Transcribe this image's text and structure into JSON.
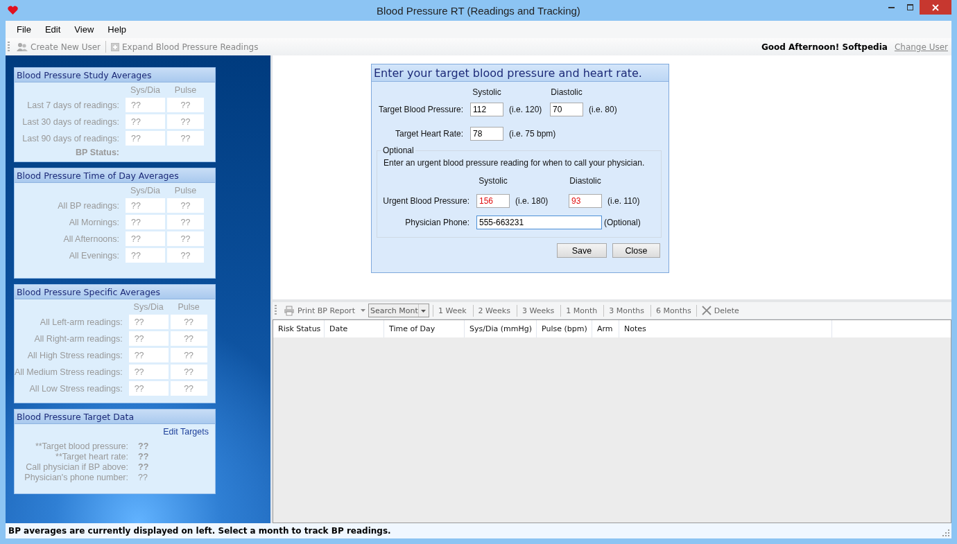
{
  "window": {
    "title": "Blood Pressure RT (Readings and Tracking)"
  },
  "menu": [
    "File",
    "Edit",
    "View",
    "Help"
  ],
  "toolbar": {
    "items": [
      {
        "label": "Create New User",
        "kind": "users"
      },
      {
        "label": "Expand Blood Pressure Readings",
        "kind": "expand"
      }
    ],
    "greeting": "Good Afternoon! Softpedia",
    "link": "Change User"
  },
  "panels": [
    {
      "title": "Blood Pressure Study Averages",
      "kind": "averages",
      "columns": [
        "Sys/Dia",
        "Pulse"
      ],
      "rows": [
        {
          "label": "Last 7 days of readings:",
          "sys_dia": "??",
          "pulse": "??"
        },
        {
          "label": "Last 30 days of readings:",
          "sys_dia": "??",
          "pulse": "??"
        },
        {
          "label": "Last 90 days of readings:",
          "sys_dia": "??",
          "pulse": "??"
        }
      ],
      "status_label": "BP Status:"
    },
    {
      "title": "Blood Pressure Time of Day Averages",
      "kind": "averages",
      "columns": [
        "Sys/Dia",
        "Pulse"
      ],
      "rows": [
        {
          "label": "All BP readings:",
          "sys_dia": "??",
          "pulse": "??"
        },
        {
          "label": "All Mornings:",
          "sys_dia": "??",
          "pulse": "??"
        },
        {
          "label": "All Afternoons:",
          "sys_dia": "??",
          "pulse": "??"
        },
        {
          "label": "All Evenings:",
          "sys_dia": "??",
          "pulse": "??"
        }
      ]
    },
    {
      "title": "Blood Pressure Specific Averages",
      "kind": "averages",
      "columns": [
        "Sys/Dia",
        "Pulse"
      ],
      "rows": [
        {
          "label": "All Left-arm readings:",
          "sys_dia": "??",
          "pulse": "??"
        },
        {
          "label": "All Right-arm readings:",
          "sys_dia": "??",
          "pulse": "??"
        },
        {
          "label": "All High Stress readings:",
          "sys_dia": "??",
          "pulse": "??"
        },
        {
          "label": "All Medium Stress readings:",
          "sys_dia": "??",
          "pulse": "??"
        },
        {
          "label": "All Low Stress readings:",
          "sys_dia": "??",
          "pulse": "??"
        }
      ]
    },
    {
      "title": "Blood Pressure Target Data",
      "kind": "targets",
      "link": "Edit Targets",
      "rows": [
        {
          "label": "**Target blood pressure:",
          "value": "??",
          "emphasized": true
        },
        {
          "label": "**Target heart rate:",
          "value": "??",
          "emphasized": true
        },
        {
          "label": "Call physician if BP above:",
          "value": "??",
          "emphasized": true
        },
        {
          "label": "Physician's phone number:",
          "value": "??",
          "emphasized": false
        }
      ]
    }
  ],
  "dialog": {
    "title": "Enter your target blood pressure and heart rate.",
    "target_headings": [
      "Systolic",
      "Diastolic"
    ],
    "target_bp": {
      "label": "Target Blood Pressure:",
      "systolic": "112",
      "systolic_hint": "(i.e. 120)",
      "diastolic": "70",
      "diastolic_hint": "(i.e. 80)",
      "alert": false
    },
    "target_hr": {
      "label": "Target Heart Rate:",
      "value": "78",
      "hint": "(i.e. 75 bpm)"
    },
    "optional": {
      "legend": "Optional",
      "instructions": "Enter an urgent blood pressure reading for when to call your physician.",
      "headings": [
        "Systolic",
        "Diastolic"
      ],
      "urgent_bp": {
        "label": "Urgent Blood Pressure:",
        "systolic": "156",
        "systolic_hint": "(i.e. 180)",
        "diastolic": "93",
        "diastolic_hint": "(i.e. 110)",
        "alert": true
      },
      "phone": {
        "label": "Physician Phone:",
        "value": "555-663231",
        "hint": "(Optional)"
      }
    },
    "buttons": [
      "Save",
      "Close"
    ]
  },
  "readings_toolbar": {
    "print": "Print BP Report",
    "search": "Search Mont",
    "ranges": [
      "1 Week",
      "2 Weeks",
      "3 Weeks",
      "1 Month",
      "3 Months",
      "6 Months"
    ],
    "delete": "Delete"
  },
  "table": {
    "columns": [
      "Risk Status",
      "Date",
      "Time of Day",
      "Sys/Dia (mmHg)",
      "Pulse (bpm)",
      "Arm",
      "Notes"
    ]
  },
  "status_bar": "BP averages are currently displayed on left. Select a month to track BP readings."
}
